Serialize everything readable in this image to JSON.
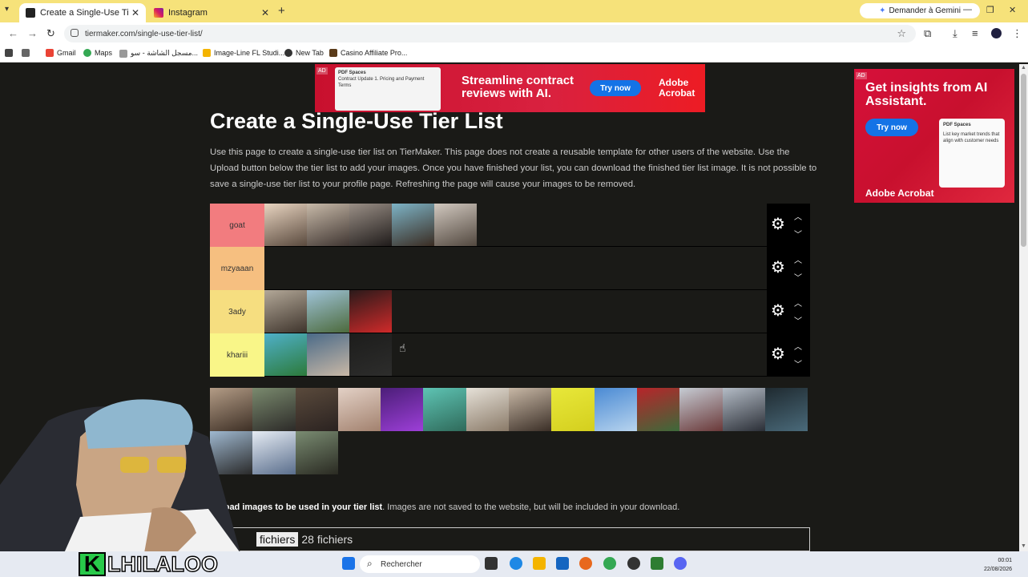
{
  "browser": {
    "tabs": [
      {
        "title": "Create a Single-Use Tier List (R",
        "active": true
      },
      {
        "title": "Instagram",
        "active": false
      }
    ],
    "gemini_label": "Demander à Gemini",
    "url": "tiermaker.com/single-use-tier-list/",
    "bookmarks": [
      "Gmail",
      "Maps",
      "مسجل الشاشة - سو...",
      "Image-Line FL Studi...",
      "New Tab",
      "Casino Affiliate Pro..."
    ]
  },
  "ads": {
    "top": {
      "label": "AD",
      "headline": "Streamline contract reviews with AI.",
      "cta": "Try now",
      "brand": "Adobe Acrobat",
      "card_title": "PDF Spaces",
      "card_text": "Contract Update 1. Pricing and Payment Terms"
    },
    "side": {
      "label": "AD",
      "headline": "Get insights from AI Assistant.",
      "cta": "Try now",
      "brand": "Adobe Acrobat",
      "card_title": "PDF Spaces",
      "card_text": "List key market trends that align with customer needs"
    }
  },
  "page": {
    "title": "Create a Single-Use Tier List",
    "intro": "Use this page to create a single-use tier list on TierMaker. This page does not create a reusable template for other users of the website. Use the Upload button below the tier list to add your images. Once you have finished your list, you can download the finished tier list image. It is not possible to save a single-use tier list to your profile page. Refreshing the page will cause your images to be removed.",
    "upload_bold": "Upload images to be used in your tier list",
    "upload_rest": ". Images are not saved to the website, but will be included in your download.",
    "file_button": "fichiers",
    "file_count": "28 fichiers"
  },
  "tiers": [
    {
      "label": "goat",
      "color": "#f27c7f",
      "images": 5
    },
    {
      "label": "mzyaaan",
      "color": "#f6bf80",
      "images": 0
    },
    {
      "label": "3ady",
      "color": "#f6de80",
      "images": 3
    },
    {
      "label": "khariii",
      "color": "#f9f688",
      "images": 3
    }
  ],
  "pool_count": 18,
  "taskbar": {
    "search": "Rechercher",
    "time": "00:01",
    "date": "22/08/2026"
  },
  "streamer": {
    "name": "LHILALOO",
    "initial": "K"
  }
}
